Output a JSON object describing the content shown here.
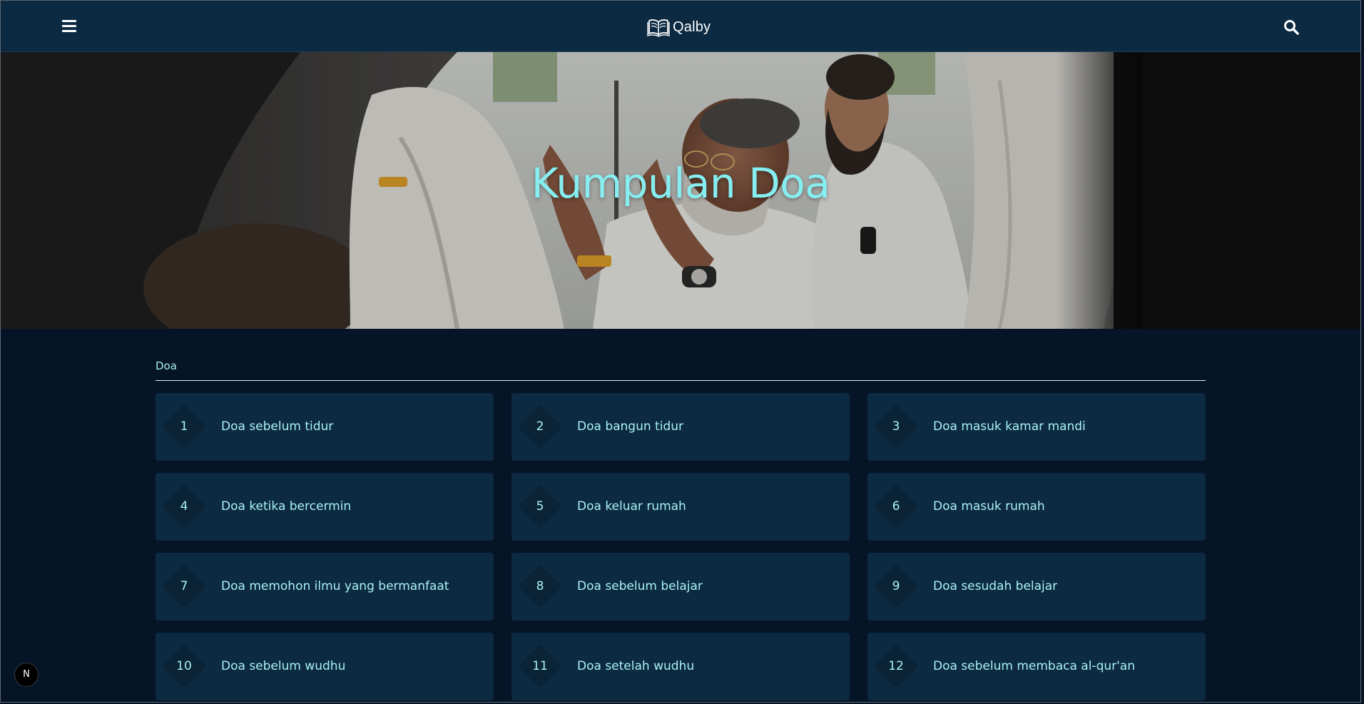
{
  "navbar": {
    "brand_name": "Qalby",
    "menu_icon": "hamburger-menu-icon",
    "search_icon": "search-icon",
    "logo_icon": "open-book-icon",
    "background": "#0c2a42"
  },
  "hero": {
    "title": "Kumpulan Doa",
    "title_color": "#86eef1"
  },
  "section": {
    "label": "Doa"
  },
  "doa_list": [
    {
      "number": "1",
      "title": "Doa sebelum tidur"
    },
    {
      "number": "2",
      "title": "Doa bangun tidur"
    },
    {
      "number": "3",
      "title": "Doa masuk kamar mandi"
    },
    {
      "number": "4",
      "title": "Doa ketika bercermin"
    },
    {
      "number": "5",
      "title": "Doa keluar rumah"
    },
    {
      "number": "6",
      "title": "Doa masuk rumah"
    },
    {
      "number": "7",
      "title": "Doa memohon ilmu yang bermanfaat"
    },
    {
      "number": "8",
      "title": "Doa sebelum belajar"
    },
    {
      "number": "9",
      "title": "Doa sesudah belajar"
    },
    {
      "number": "10",
      "title": "Doa sebelum wudhu"
    },
    {
      "number": "11",
      "title": "Doa setelah wudhu"
    },
    {
      "number": "12",
      "title": "Doa sebelum membaca al-qur'an"
    }
  ],
  "dev_badge": {
    "label": "N"
  },
  "colors": {
    "page_background": "#051426",
    "card_background": "#0c2a42",
    "accent_text": "#a9f2f2"
  }
}
